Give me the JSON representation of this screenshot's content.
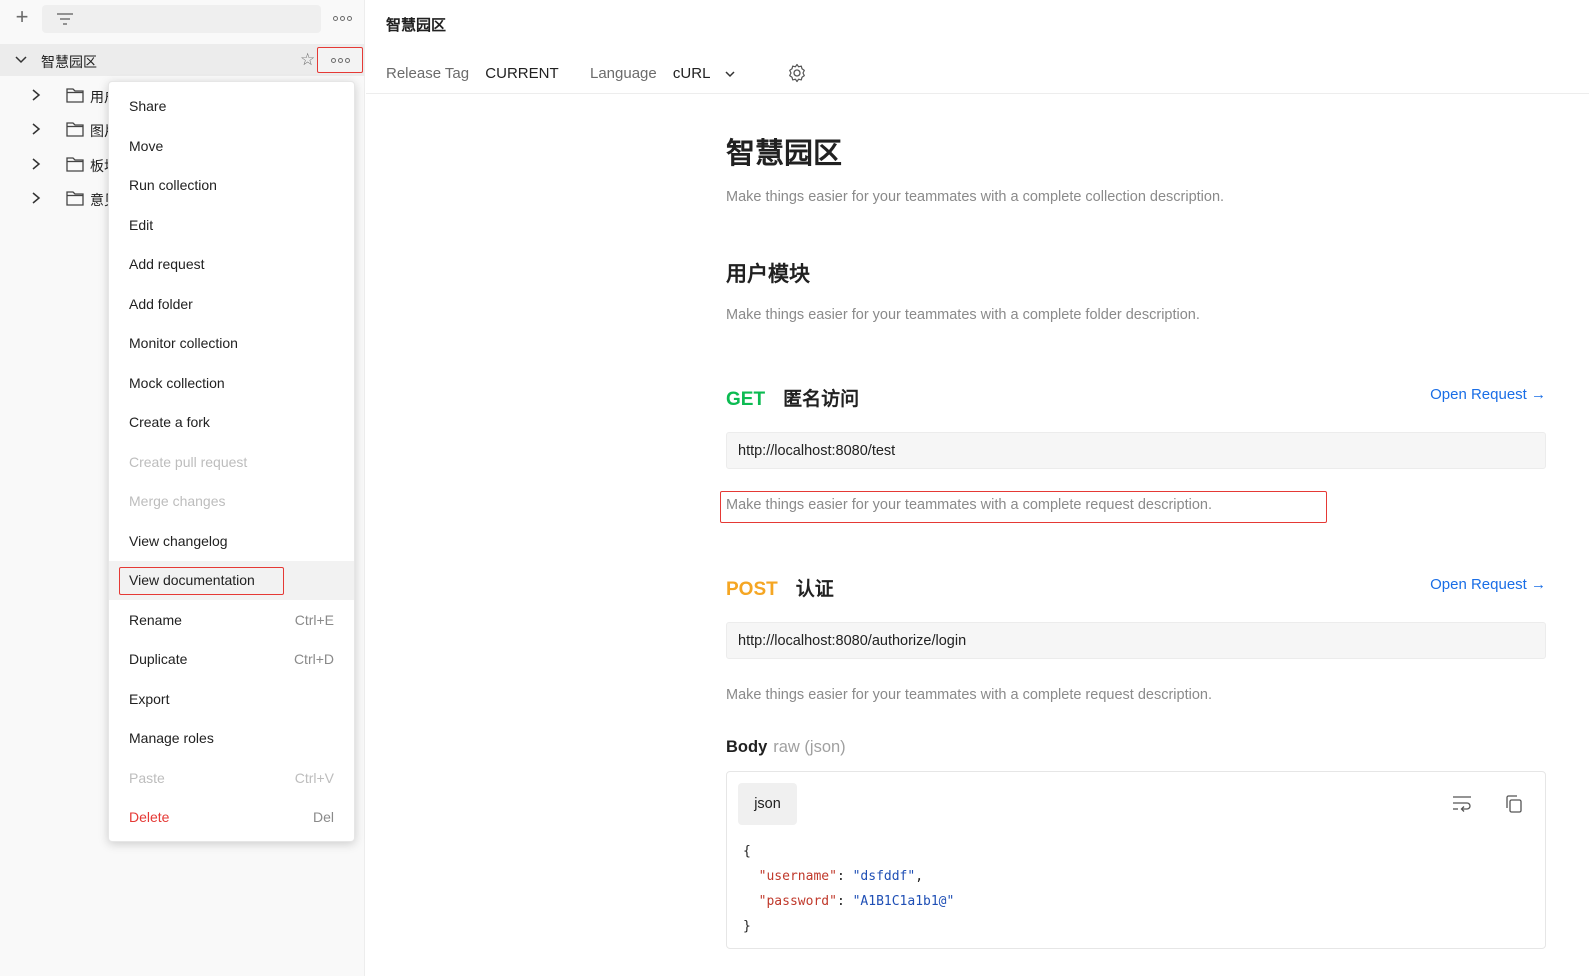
{
  "sidebar": {
    "collection_name": "智慧园区",
    "folders": [
      {
        "label": "用户模块"
      },
      {
        "label": "图片"
      },
      {
        "label": "板块"
      },
      {
        "label": "意见"
      }
    ]
  },
  "context_menu": {
    "items": [
      {
        "label": "Share",
        "shortcut": "",
        "state": "normal"
      },
      {
        "label": "Move",
        "shortcut": "",
        "state": "normal"
      },
      {
        "label": "Run collection",
        "shortcut": "",
        "state": "normal"
      },
      {
        "label": "Edit",
        "shortcut": "",
        "state": "normal"
      },
      {
        "label": "Add request",
        "shortcut": "",
        "state": "normal"
      },
      {
        "label": "Add folder",
        "shortcut": "",
        "state": "normal"
      },
      {
        "label": "Monitor collection",
        "shortcut": "",
        "state": "normal"
      },
      {
        "label": "Mock collection",
        "shortcut": "",
        "state": "normal"
      },
      {
        "label": "Create a fork",
        "shortcut": "",
        "state": "normal"
      },
      {
        "label": "Create pull request",
        "shortcut": "",
        "state": "disabled"
      },
      {
        "label": "Merge changes",
        "shortcut": "",
        "state": "disabled"
      },
      {
        "label": "View changelog",
        "shortcut": "",
        "state": "normal"
      },
      {
        "label": "View documentation",
        "shortcut": "",
        "state": "highlight"
      },
      {
        "label": "Rename",
        "shortcut": "Ctrl+E",
        "state": "normal"
      },
      {
        "label": "Duplicate",
        "shortcut": "Ctrl+D",
        "state": "normal"
      },
      {
        "label": "Export",
        "shortcut": "",
        "state": "normal"
      },
      {
        "label": "Manage roles",
        "shortcut": "",
        "state": "normal"
      },
      {
        "label": "Paste",
        "shortcut": "Ctrl+V",
        "state": "disabled"
      },
      {
        "label": "Delete",
        "shortcut": "Del",
        "state": "danger"
      }
    ]
  },
  "header": {
    "title": "智慧园区",
    "release_tag_label": "Release Tag",
    "release_tag_value": "CURRENT",
    "language_label": "Language",
    "language_value": "cURL"
  },
  "doc": {
    "title": "智慧园区",
    "collection_desc": "Make things easier for your teammates with a complete collection description.",
    "folder_title": "用户模块",
    "folder_desc": "Make things easier for your teammates with a complete folder description.",
    "open_request_label": "Open Request →",
    "requests": [
      {
        "method": "GET",
        "name": "匿名访问",
        "url": "http://localhost:8080/test",
        "desc": "Make things easier for your teammates with a complete request description."
      },
      {
        "method": "POST",
        "name": "认证",
        "url": "http://localhost:8080/authorize/login",
        "desc": "Make things easier for your teammates with a complete request description."
      }
    ],
    "body_label": "Body",
    "body_type": "raw (json)",
    "code_tab": "json",
    "code": {
      "open": "{",
      "close": "}",
      "username_key": "\"username\"",
      "username_val": "\"dsfddf\"",
      "password_key": "\"password\"",
      "password_val": "\"A1B1C1a1b1@\""
    }
  },
  "colors": {
    "get": "#0cbb52",
    "post": "#f5a623",
    "link": "#1a6ee6",
    "danger": "#e53935",
    "highlight_border": "#e53935"
  }
}
